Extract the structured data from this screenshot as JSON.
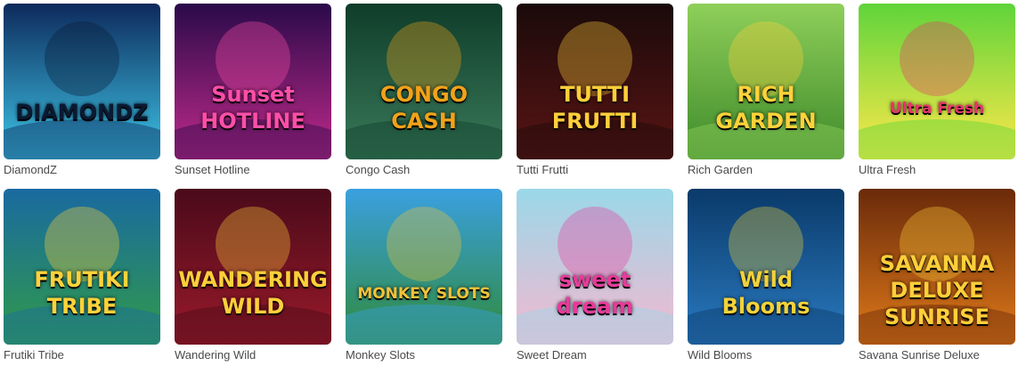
{
  "games": [
    {
      "title": "DiamondZ",
      "art_text": [
        "DIAMONDZ"
      ],
      "colors": [
        "#0d2a5c",
        "#3ec6e8",
        "#0a1a33"
      ],
      "art": "diamond-art"
    },
    {
      "title": "Sunset Hotline",
      "art_text": [
        "Sunset",
        "HOTLINE"
      ],
      "colors": [
        "#2a0a4a",
        "#c02a8a",
        "#ff4fa8"
      ],
      "art": "neon-sunset-art"
    },
    {
      "title": "Congo Cash",
      "art_text": [
        "CONGO",
        "CASH"
      ],
      "colors": [
        "#0f3d2a",
        "#3a7a5a",
        "#f2a21a"
      ],
      "art": "gorilla-art"
    },
    {
      "title": "Tutti Frutti",
      "art_text": [
        "TUTTI",
        "FRUTTI"
      ],
      "colors": [
        "#1a0a0a",
        "#5a1414",
        "#ffcf3a"
      ],
      "art": "fruit-dancer-art"
    },
    {
      "title": "Rich Garden",
      "art_text": [
        "RICH",
        "GARDEN"
      ],
      "colors": [
        "#8fcf5a",
        "#3e8a2a",
        "#ffd23a"
      ],
      "art": "garden-art"
    },
    {
      "title": "Ultra Fresh",
      "art_text": [
        "Ultra Fresh"
      ],
      "colors": [
        "#5fd43a",
        "#ffe84a",
        "#e8356a"
      ],
      "art": "raspberry-art"
    },
    {
      "title": "Frutiki Tribe",
      "art_text": [
        "FRUTIKI",
        "TRIBE"
      ],
      "colors": [
        "#1a6aa0",
        "#2f9a4a",
        "#ffd23a"
      ],
      "art": "tiki-art"
    },
    {
      "title": "Wandering Wild",
      "art_text": [
        "WANDERING",
        "WILD"
      ],
      "colors": [
        "#4a0a1a",
        "#9a1a2a",
        "#ffcf3a"
      ],
      "art": "seven-fruit-art"
    },
    {
      "title": "Monkey Slots",
      "art_text": [
        "MONKEY SLOTS"
      ],
      "colors": [
        "#3aa0e0",
        "#2f8a3a",
        "#f2c23a"
      ],
      "art": "monkey-art"
    },
    {
      "title": "Sweet Dream",
      "art_text": [
        "sweet",
        "dream"
      ],
      "colors": [
        "#9ad8e8",
        "#f5b8d0",
        "#e83a9a"
      ],
      "art": "candy-art"
    },
    {
      "title": "Wild Blooms",
      "art_text": [
        "Wild",
        "Blooms"
      ],
      "colors": [
        "#0a3a6a",
        "#2a7ac0",
        "#f2d23a"
      ],
      "art": "flower-art"
    },
    {
      "title": "Savana Sunrise Deluxe",
      "art_text": [
        "SAVANNA",
        "DELUXE",
        "SUNRISE"
      ],
      "colors": [
        "#6a2a0a",
        "#e07a1a",
        "#ffcf3a"
      ],
      "art": "savanna-art"
    }
  ]
}
